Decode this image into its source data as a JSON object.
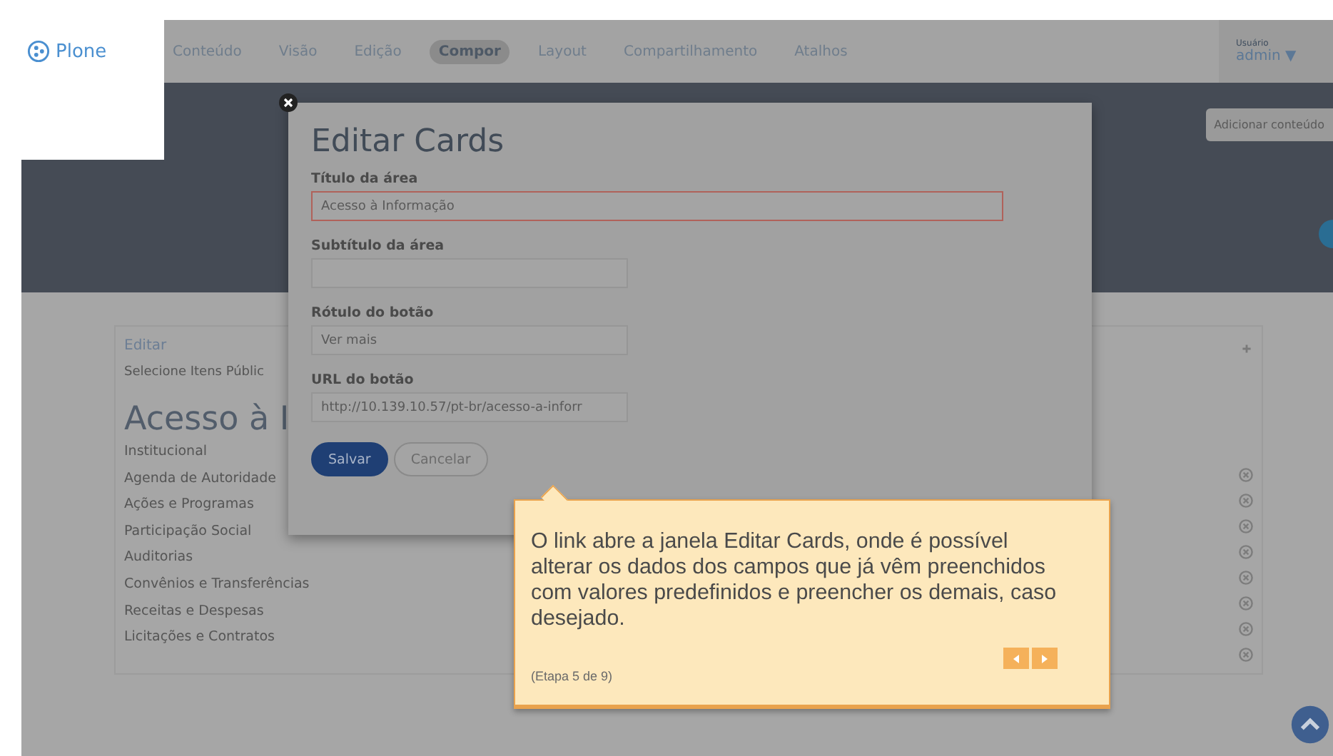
{
  "toolbar": {
    "logo": "Plone",
    "menu": [
      {
        "label": "Conteúdo",
        "selected": false
      },
      {
        "label": "Visão",
        "selected": false
      },
      {
        "label": "Edição",
        "selected": false
      },
      {
        "label": "Compor",
        "selected": true
      },
      {
        "label": "Layout",
        "selected": false
      },
      {
        "label": "Compartilhamento",
        "selected": false
      },
      {
        "label": "Atalhos",
        "selected": false
      }
    ],
    "user": {
      "caption": "Usuário",
      "name": "admin",
      "caret": "▼"
    }
  },
  "header": {
    "add_button": "Adicionar conteúdo"
  },
  "card": {
    "edit_link": "Editar",
    "hint": "Selecione Itens Públic",
    "title": "Acesso à I",
    "items": [
      "Institucional",
      "Agenda de Autoridade",
      "Ações e Programas",
      "Participação Social",
      "Auditorias",
      "Convênios e Transferências",
      "Receitas e Despesas",
      "Licitações e Contratos"
    ]
  },
  "modal": {
    "title": "Editar Cards",
    "fields": [
      {
        "label": "Título da área",
        "value": "Acesso à Informação",
        "focused": true
      },
      {
        "label": "Subtítulo da área",
        "focused": false
      },
      {
        "label": "Rótulo do botão",
        "value": "Ver mais",
        "focused": false
      },
      {
        "label": "URL do botão",
        "value": "http://10.139.10.57/pt-br/acesso-a-inforr",
        "focused": false
      }
    ],
    "buttons": [
      {
        "label": "Salvar",
        "kind": "primary"
      },
      {
        "label": "Cancelar",
        "kind": "secondary"
      }
    ]
  },
  "tour": {
    "text": "O link abre a janela Editar Cards, onde é possível alterar os dados dos campos que já vêm preenchidos com valores predefinidos e preencher os demais, caso desejado.",
    "step": "(Etapa 5 de 9)"
  }
}
